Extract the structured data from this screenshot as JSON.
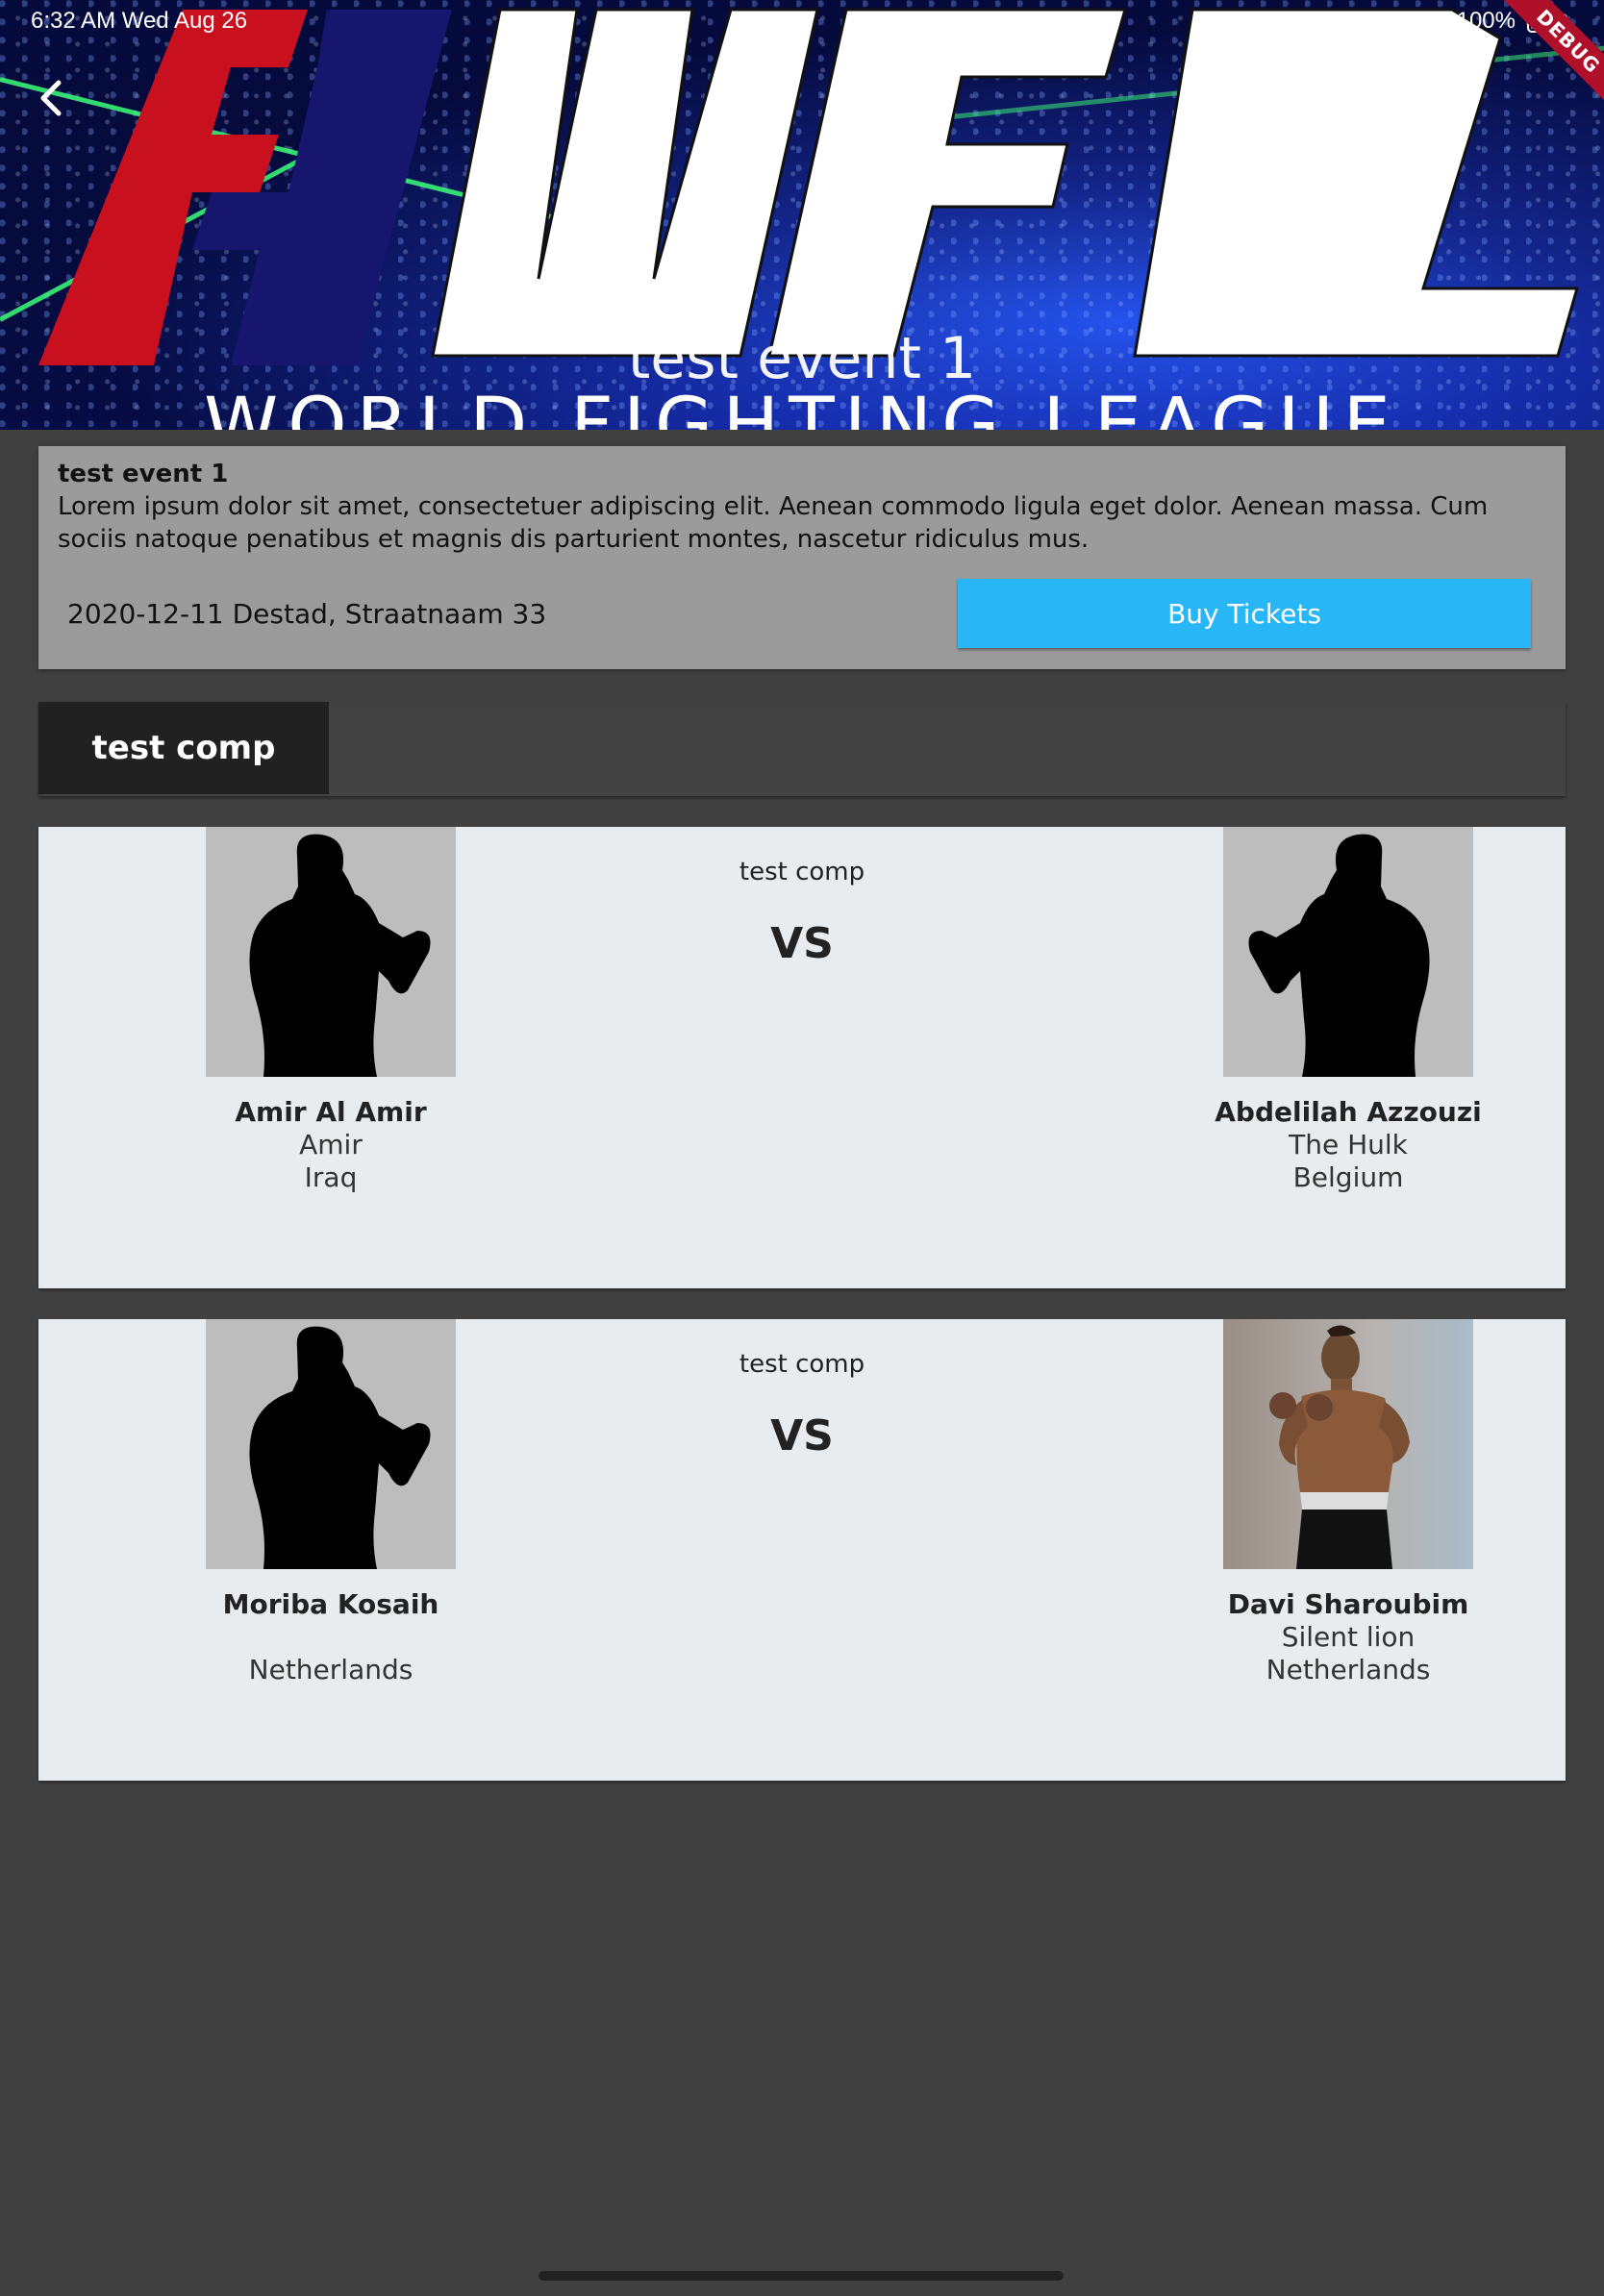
{
  "status_bar": {
    "time": "6:32 AM  Wed Aug 26",
    "battery": "100%",
    "debug_label": "DEBUG"
  },
  "header": {
    "logo_text": "FWFL",
    "event_title": "test event 1",
    "tagline": "WORLD FIGHTING LEAGUE",
    "back_icon": "chevron-left-icon"
  },
  "event": {
    "title": "test event 1",
    "description": "Lorem ipsum dolor sit amet, consectetuer adipiscing elit. Aenean commodo ligula eget dolor. Aenean massa. Cum sociis natoque penatibus et magnis dis parturient montes, nascetur ridiculus mus.",
    "date_location": "2020-12-11 Destad, Straatnaam 33",
    "buy_label": "Buy Tickets"
  },
  "tabs": [
    {
      "label": "test comp",
      "selected": true
    }
  ],
  "fights": [
    {
      "competition": "test comp",
      "vs": "VS",
      "left": {
        "name": "Amir Al Amir",
        "nickname": "Amir",
        "country": "Iraq",
        "photo": "silhouette"
      },
      "right": {
        "name": "Abdelilah Azzouzi",
        "nickname": "The Hulk",
        "country": "Belgium",
        "photo": "silhouette"
      }
    },
    {
      "competition": "test comp",
      "vs": "VS",
      "left": {
        "name": "Moriba Kosaih",
        "nickname": "",
        "country": "Netherlands",
        "photo": "silhouette"
      },
      "right": {
        "name": "Davi Sharoubim",
        "nickname": "Silent lion",
        "country": "Netherlands",
        "photo": "photo"
      }
    }
  ],
  "colors": {
    "background": "#404040",
    "accent": "#29b6f6",
    "card": "#e8ecef",
    "info_card": "#9b9b9b",
    "tab_selected": "#212121",
    "logo_red": "#c8101e",
    "logo_blue": "#16166e"
  }
}
